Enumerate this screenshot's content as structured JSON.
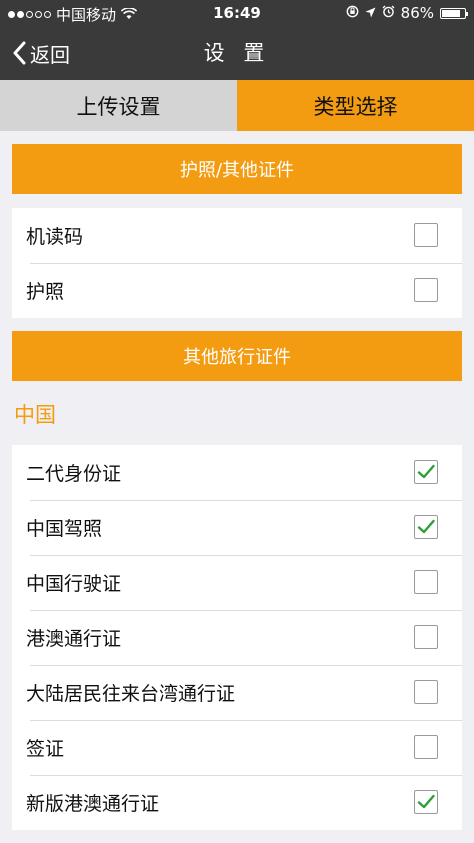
{
  "status_bar": {
    "carrier": "中国移动",
    "time": "16:49",
    "battery": "86%",
    "battery_level": 0.86
  },
  "nav": {
    "back_label": "返回",
    "title": "设 置"
  },
  "tabs": [
    {
      "label": "上传设置",
      "active": false
    },
    {
      "label": "类型选择",
      "active": true
    }
  ],
  "section1": {
    "header": "护照/其他证件",
    "items": [
      {
        "label": "机读码",
        "checked": false
      },
      {
        "label": "护照",
        "checked": false
      }
    ]
  },
  "section2": {
    "header": "其他旅行证件",
    "group_title": "中国",
    "items": [
      {
        "label": "二代身份证",
        "checked": true
      },
      {
        "label": "中国驾照",
        "checked": true
      },
      {
        "label": "中国行驶证",
        "checked": false
      },
      {
        "label": "港澳通行证",
        "checked": false
      },
      {
        "label": "大陆居民往来台湾通行证",
        "checked": false
      },
      {
        "label": "签证",
        "checked": false
      },
      {
        "label": "新版港澳通行证",
        "checked": true
      }
    ]
  },
  "colors": {
    "accent": "#f39c12",
    "nav_bg": "#3a3a3a",
    "check": "#2e9e3a"
  }
}
